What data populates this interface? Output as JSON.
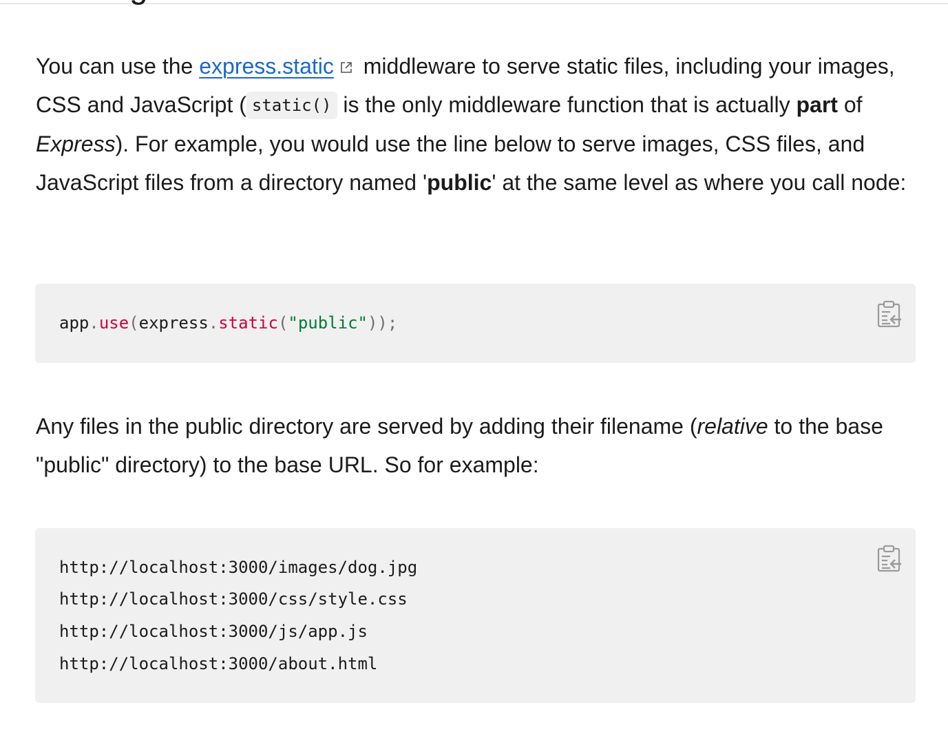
{
  "section": {
    "heading_fragment": "Serving static files"
  },
  "para1": {
    "t1": "You can use the ",
    "link": "express.static",
    "t2": " middleware to serve static files, including your images, CSS and JavaScript (",
    "code": "static()",
    "t3": " is the only middleware function that is actually ",
    "b1": "part",
    "t4": " of ",
    "i1": "Express",
    "t5": "). For example, you would use the line below to serve images, CSS files, and JavaScript files from a directory named '",
    "b2": "public",
    "t6": "' at the same level as where you call node:"
  },
  "code1": {
    "tokens": {
      "app": "app",
      "dot1": ".",
      "use": "use",
      "paren_open1": "(",
      "express": "express",
      "dot2": ".",
      "static": "static",
      "paren_open2": "(",
      "str": "\"public\"",
      "close": "));"
    }
  },
  "para2": {
    "t1": "Any files in the public directory are served by adding their filename (",
    "i1": "relative",
    "t2": " to the base \"public\" directory) to the base URL. So for example:"
  },
  "code2": {
    "lines": [
      "http://localhost:3000/images/dog.jpg",
      "http://localhost:3000/css/style.css",
      "http://localhost:3000/js/app.js",
      "http://localhost:3000/about.html"
    ]
  },
  "icons": {
    "external_link": "external-link-icon",
    "copy": "clipboard-copy-icon"
  }
}
